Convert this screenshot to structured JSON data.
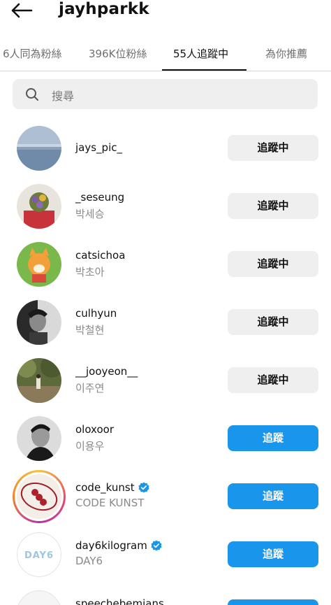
{
  "header": {
    "title": "jayhparkk"
  },
  "tabs": [
    {
      "label": "6人同為粉絲"
    },
    {
      "label": "396K位粉絲"
    },
    {
      "label": "55人追蹤中"
    },
    {
      "label": "為你推薦"
    }
  ],
  "search": {
    "placeholder": "搜尋"
  },
  "users": [
    {
      "username": "jays_pic_",
      "subname": "",
      "verified": false,
      "button": "追蹤中"
    },
    {
      "username": "_seseung",
      "subname": "박세승",
      "verified": false,
      "button": "追蹤中"
    },
    {
      "username": "catsichoa",
      "subname": "박초아",
      "verified": false,
      "button": "追蹤中"
    },
    {
      "username": "culhyun",
      "subname": "박철현",
      "verified": false,
      "button": "追蹤中"
    },
    {
      "username": "__jooyeon__",
      "subname": "이주연",
      "verified": false,
      "button": "追蹤中"
    },
    {
      "username": "oloxoor",
      "subname": "이용우",
      "verified": false,
      "button": "追蹤"
    },
    {
      "username": "code_kunst",
      "subname": "CODE KUNST",
      "verified": true,
      "button": "追蹤"
    },
    {
      "username": "day6kilogram",
      "subname": "DAY6",
      "verified": true,
      "button": "追蹤",
      "avatar_text": "DAY6"
    },
    {
      "username": "speechebemians",
      "subname": "",
      "verified": false,
      "button": "追蹤"
    }
  ],
  "colors": {
    "follow_button": "#1a95ec",
    "following_button": "#efefef",
    "verified_badge": "#1a95ec"
  }
}
